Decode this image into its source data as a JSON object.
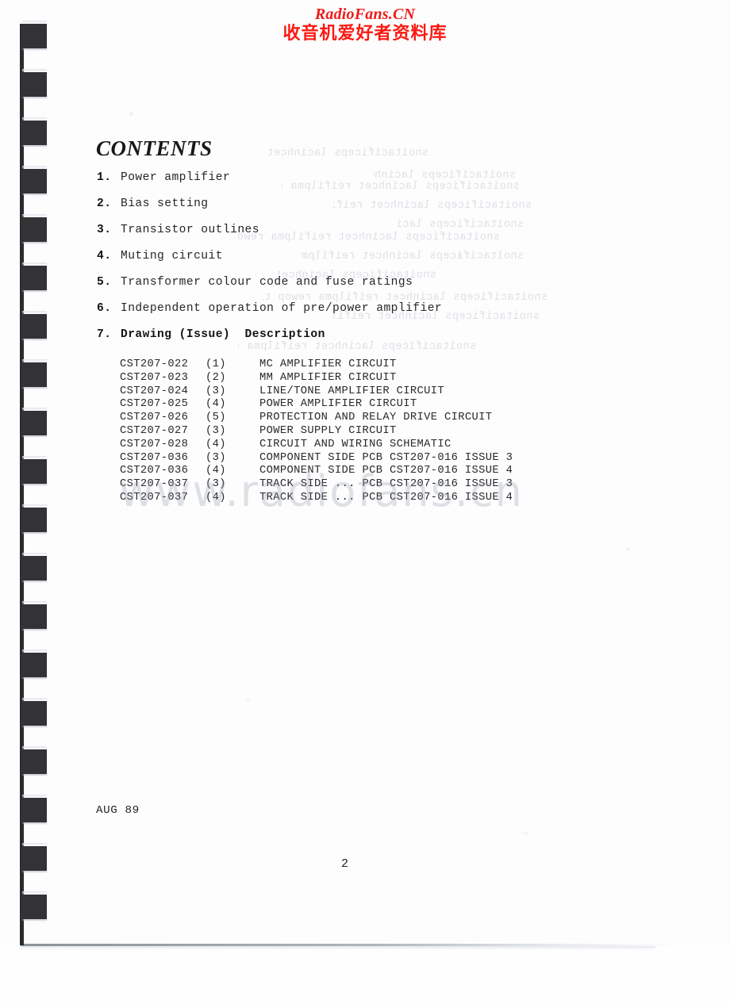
{
  "watermarks": {
    "brand_latin": "RadioFans.CN",
    "brand_cjk": "收音机爱好者资料库",
    "url": "www.radiofans.cn",
    "brand_color": "#ef1c17"
  },
  "document": {
    "title": "CONTENTS",
    "date": "AUG 89",
    "page_number": "2",
    "toc": [
      {
        "num": "1.",
        "text": "Power amplifier"
      },
      {
        "num": "2.",
        "text": "Bias setting"
      },
      {
        "num": "3.",
        "text": "Transistor outlines"
      },
      {
        "num": "4.",
        "text": "Muting circuit"
      },
      {
        "num": "5.",
        "text": "Transformer colour code and fuse ratings"
      },
      {
        "num": "6.",
        "text": "Independent operation of pre/power amplifier"
      },
      {
        "num": "7.",
        "text": "Drawing (Issue)  Description"
      }
    ],
    "drawings_header": {
      "drawing": "Drawing",
      "issue": "(Issue)",
      "description": "Description"
    },
    "drawings": [
      {
        "code": "CST207-022",
        "issue": "(1)",
        "description": "MC AMPLIFIER CIRCUIT"
      },
      {
        "code": "CST207-023",
        "issue": "(2)",
        "description": "MM AMPLIFIER CIRCUIT"
      },
      {
        "code": "CST207-024",
        "issue": "(3)",
        "description": "LINE/TONE AMPLIFIER CIRCUIT"
      },
      {
        "code": "CST207-025",
        "issue": "(4)",
        "description": "POWER AMPLIFIER CIRCUIT"
      },
      {
        "code": "CST207-026",
        "issue": "(5)",
        "description": "PROTECTION AND RELAY DRIVE CIRCUIT"
      },
      {
        "code": "CST207-027",
        "issue": "(3)",
        "description": "POWER SUPPLY CIRCUIT"
      },
      {
        "code": "CST207-028",
        "issue": "(4)",
        "description": "CIRCUIT AND WIRING SCHEMATIC"
      },
      {
        "code": "CST207-036",
        "issue": "(3)",
        "description": "COMPONENT SIDE PCB CST207-016 ISSUE 3"
      },
      {
        "code": "CST207-036",
        "issue": "(4)",
        "description": "COMPONENT SIDE PCB CST207-016 ISSUE 4"
      },
      {
        "code": "CST207-037",
        "issue": "(3)",
        "description": "TRACK SIDE ... PCB CST207-016 ISSUE 3"
      },
      {
        "code": "CST207-037",
        "issue": "(4)",
        "description": "TRACK SIDE ... PCB CST207-016 ISSUE 4"
      }
    ]
  },
  "binding": {
    "type": "comb-binding",
    "tooth_count": 19
  }
}
